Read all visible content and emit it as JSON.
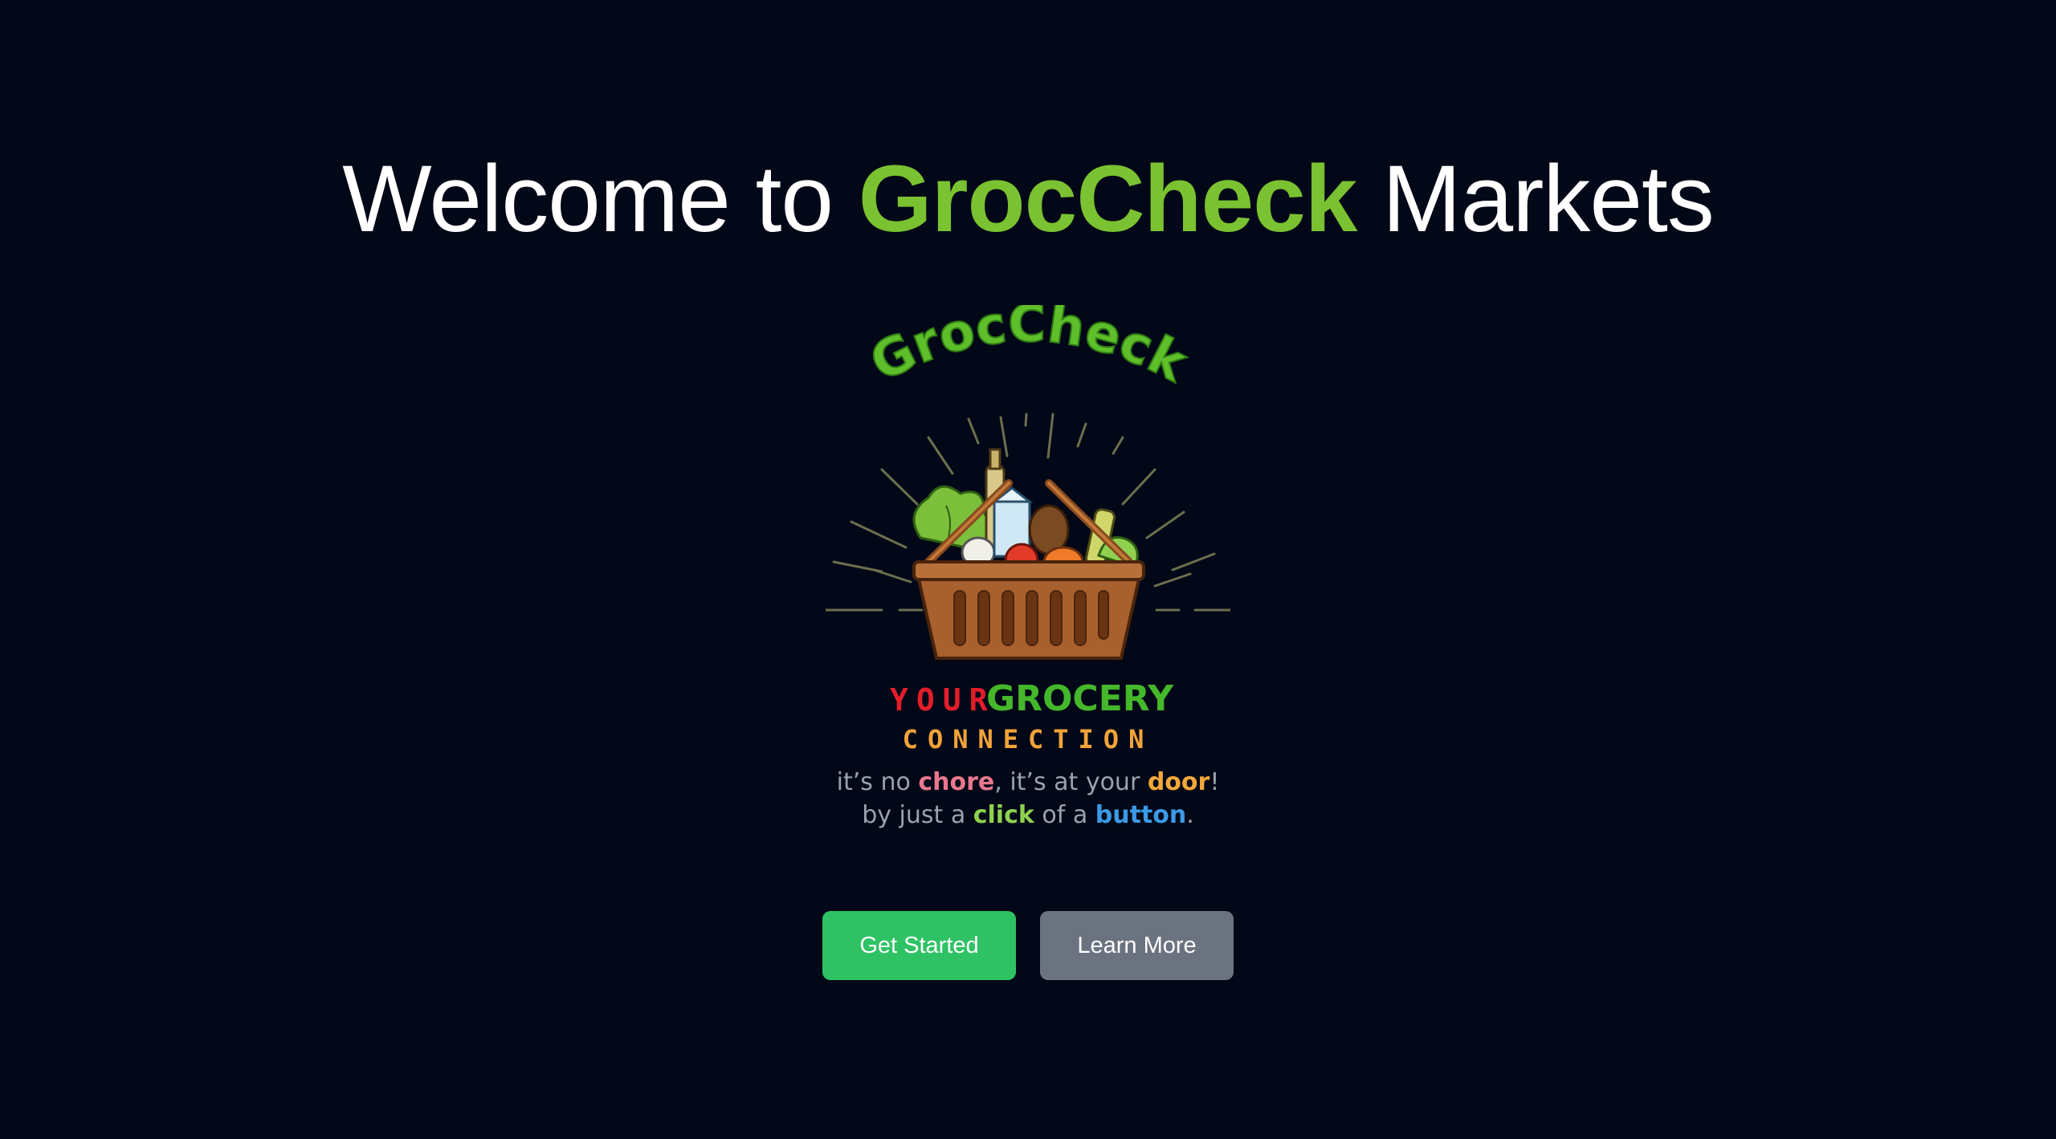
{
  "hero": {
    "prefix": "Welcome to ",
    "brand": "GrocCheck",
    "suffix": " Markets"
  },
  "logo": {
    "wordmark": "GrocCheck",
    "your": "YOUR",
    "grocery": "GROCERY",
    "connection": "CONNECTION",
    "tagline_line1": {
      "a": "it’s no ",
      "chore": "chore",
      "b": ", it’s at your ",
      "door": "door",
      "c": "!"
    },
    "tagline_line2": {
      "a": "by just a ",
      "click": "click",
      "b": " of a ",
      "button": "button",
      "c": "."
    }
  },
  "actions": {
    "get_started": "Get Started",
    "learn_more": "Learn More"
  },
  "colors": {
    "background": "#020817",
    "brand_green": "#7ac231",
    "primary_button": "#2fc264",
    "secondary_button": "#6b7280"
  }
}
